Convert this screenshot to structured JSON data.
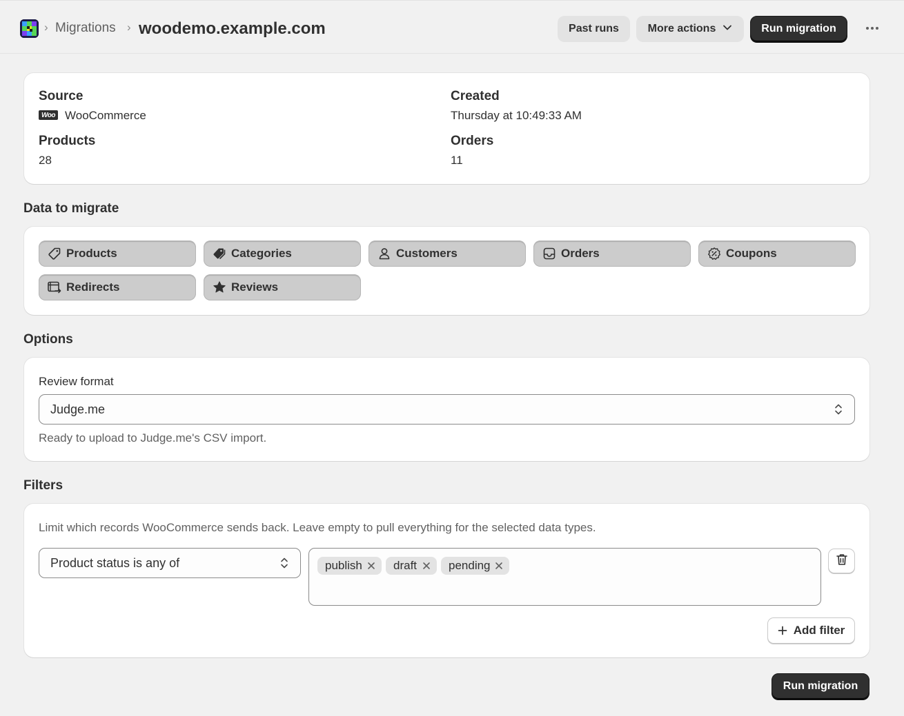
{
  "header": {
    "breadcrumb_parent": "Migrations",
    "title": "woodemo.example.com",
    "past_runs_label": "Past runs",
    "more_actions_label": "More actions",
    "run_migration_label": "Run migration"
  },
  "summary": {
    "source_label": "Source",
    "source_value": "WooCommerce",
    "source_badge_text": "Woo",
    "created_label": "Created",
    "created_value": "Thursday at 10:49:33 AM",
    "products_label": "Products",
    "products_value": "28",
    "orders_label": "Orders",
    "orders_value": "11"
  },
  "data_to_migrate": {
    "title": "Data to migrate",
    "items": [
      {
        "label": "Products",
        "icon": "tag-icon",
        "selected": true
      },
      {
        "label": "Categories",
        "icon": "tags-icon",
        "selected": true
      },
      {
        "label": "Customers",
        "icon": "person-icon",
        "selected": true
      },
      {
        "label": "Orders",
        "icon": "inbox-icon",
        "selected": true
      },
      {
        "label": "Coupons",
        "icon": "discount-icon",
        "selected": true
      },
      {
        "label": "Redirects",
        "icon": "redirect-icon",
        "selected": true
      },
      {
        "label": "Reviews",
        "icon": "star-icon",
        "selected": true
      }
    ]
  },
  "options": {
    "title": "Options",
    "review_format_label": "Review format",
    "review_format_value": "Judge.me",
    "help_text": "Ready to upload to Judge.me's CSV import."
  },
  "filters": {
    "title": "Filters",
    "description": "Limit which records WooCommerce sends back. Leave empty to pull everything for the selected data types.",
    "filter_field_value": "Product status is any of",
    "tags": [
      "publish",
      "draft",
      "pending"
    ],
    "add_filter_label": "Add filter"
  },
  "footer": {
    "run_migration_label": "Run migration"
  },
  "colors": {
    "background": "#f1f1f1",
    "card": "#ffffff",
    "primary_button": "#303030",
    "chip_selected": "#cccccc"
  }
}
